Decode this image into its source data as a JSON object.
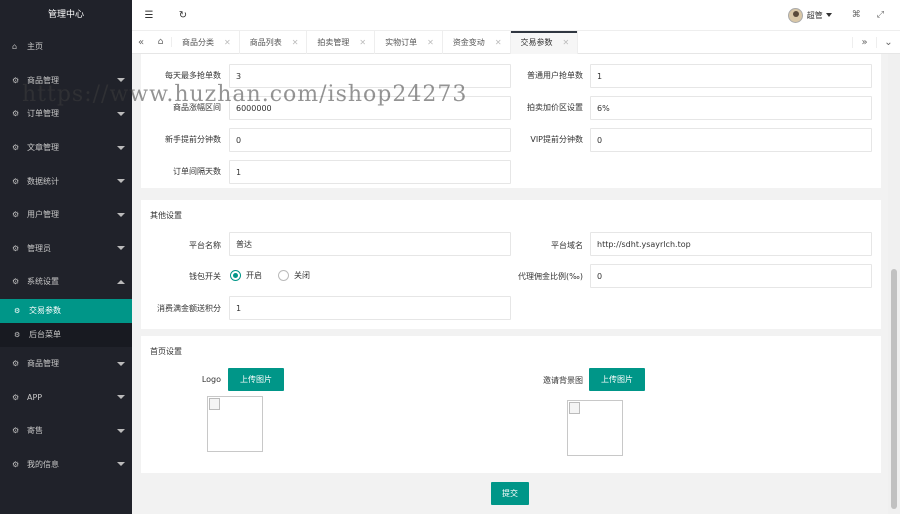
{
  "app": {
    "title": "管理中心"
  },
  "sidebar": {
    "items": [
      {
        "label": "主页",
        "icon": "home-icon"
      },
      {
        "label": "商品管理",
        "icon": "gear-icon"
      },
      {
        "label": "订单管理",
        "icon": "gear-icon"
      },
      {
        "label": "文章管理",
        "icon": "gear-icon"
      },
      {
        "label": "数据统计",
        "icon": "gear-icon"
      },
      {
        "label": "用户管理",
        "icon": "gear-icon"
      },
      {
        "label": "管理员",
        "icon": "gear-icon"
      },
      {
        "label": "系统设置",
        "icon": "gear-icon"
      }
    ],
    "sub_items": [
      {
        "label": "交易参数",
        "active": true
      },
      {
        "label": "后台菜单",
        "active": false
      }
    ],
    "items_after": [
      {
        "label": "商品管理",
        "icon": "gear-icon"
      },
      {
        "label": "APP",
        "icon": "gear-icon"
      },
      {
        "label": "寄售",
        "icon": "gear-icon"
      },
      {
        "label": "我的信息",
        "icon": "gear-icon"
      }
    ]
  },
  "header": {
    "user_name": "超管"
  },
  "tabs": [
    {
      "label": "商品分类"
    },
    {
      "label": "商品列表"
    },
    {
      "label": "拍卖管理"
    },
    {
      "label": "实物订单"
    },
    {
      "label": "资金变动"
    },
    {
      "label": "交易参数",
      "active": true
    }
  ],
  "trade_params": {
    "fields": [
      {
        "label": "每天最多抢单数",
        "value": "3"
      },
      {
        "label": "普通用户抢单数",
        "value": "1"
      },
      {
        "label": "商品涨幅区间",
        "value": "6000000"
      },
      {
        "label": "拍卖加价区设置",
        "value": "6%"
      },
      {
        "label": "新手提前分钟数",
        "value": "0"
      },
      {
        "label": "VIP提前分钟数",
        "value": "0"
      },
      {
        "label": "订单间隔天数",
        "value": "1"
      }
    ]
  },
  "other_settings": {
    "title": "其他设置",
    "platform_name_label": "平台名称",
    "platform_name_value": "普达",
    "platform_domain_label": "平台域名",
    "platform_domain_value": "http://sdht.ysayrlch.top",
    "wallet_label": "钱包开关",
    "wallet_on": "开启",
    "wallet_off": "关闭",
    "commission_label": "代理佣金比例(‰)",
    "commission_value": "0",
    "points_label": "消费满金额送积分",
    "points_value": "1"
  },
  "home_settings": {
    "title": "首页设置",
    "logo_label": "Logo",
    "invite_bg_label": "邀请背景图",
    "upload_label": "上传图片"
  },
  "submit_label": "提交",
  "watermark": "https://www.huzhan.com/ishop24273",
  "colors": {
    "accent": "#009688",
    "sidebar_bg": "#20222a"
  }
}
